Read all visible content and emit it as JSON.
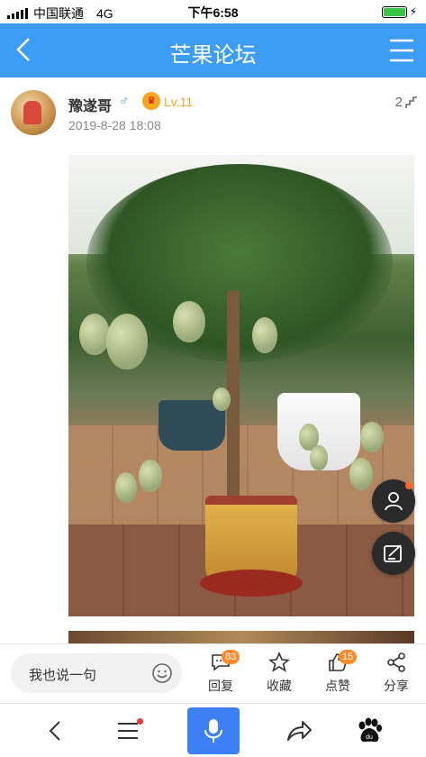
{
  "status_bar": {
    "carrier": "中国联通",
    "network": "4G",
    "time": "下午6:58"
  },
  "nav": {
    "title": "芒果论坛"
  },
  "post": {
    "username": "豫遂哥",
    "gender_symbol": "♂",
    "level": "Lv.11",
    "timestamp": "2019-8-28 18:08",
    "floor_count": "2"
  },
  "comment": {
    "placeholder": "我也说一句"
  },
  "actions": [
    {
      "label": "回复",
      "badge": "83",
      "icon": "reply-icon"
    },
    {
      "label": "收藏",
      "badge": "",
      "icon": "star-icon"
    },
    {
      "label": "点赞",
      "badge": "15",
      "icon": "thumbs-up-icon"
    },
    {
      "label": "分享",
      "badge": "",
      "icon": "share-icon"
    }
  ],
  "colors": {
    "brand": "#3d9df5",
    "badge": "#ff8a2a",
    "level": "#f5a623",
    "mic": "#3d7ff5"
  }
}
